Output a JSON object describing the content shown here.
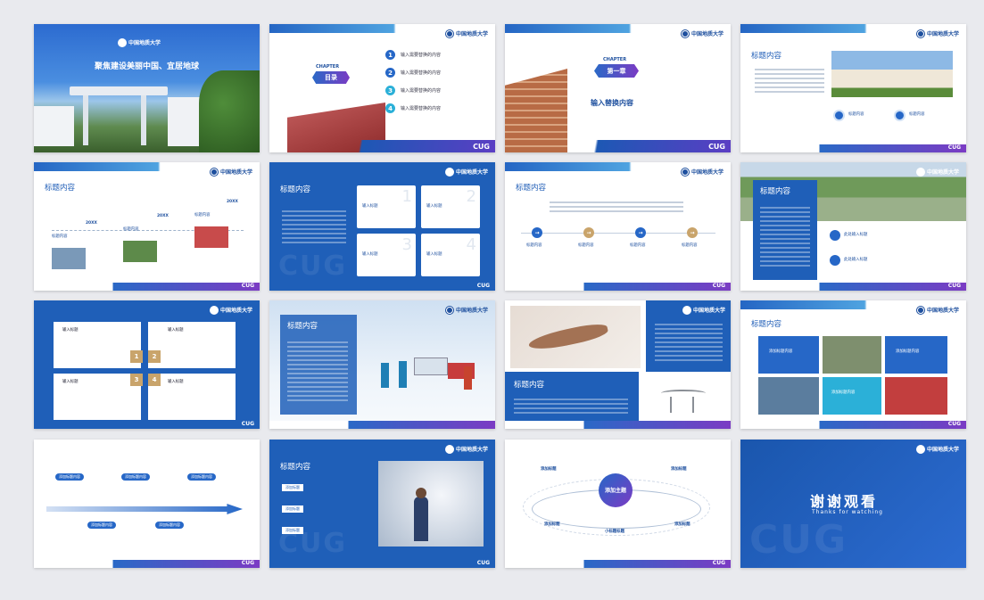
{
  "brand": {
    "logo_text": "中国地质大学",
    "short": "CUG",
    "colors": {
      "primary": "#1f5fb8",
      "accent": "#7b3bc4",
      "gold": "#c9a46b"
    }
  },
  "slides": {
    "cover": {
      "title": "聚焦建设美丽中国、宜居地球"
    },
    "toc": {
      "chapter": "CHAPTER",
      "title": "目录",
      "items": [
        {
          "num": "1",
          "text": "输入需要替换的内容"
        },
        {
          "num": "2",
          "text": "输入需要替换的内容"
        },
        {
          "num": "3",
          "text": "输入需要替换的内容"
        },
        {
          "num": "4",
          "text": "输入需要替换的内容"
        }
      ]
    },
    "chapter1": {
      "chapter": "CHAPTER",
      "title": "第一章",
      "subtitle": "输入替换内容"
    },
    "s4": {
      "title": "标题内容",
      "items": [
        "标题内容",
        "标题内容"
      ]
    },
    "s5": {
      "title": "标题内容",
      "years": [
        "20XX",
        "20XX",
        "20XX"
      ],
      "labels": [
        "标题内容",
        "标题内容",
        "标题内容"
      ]
    },
    "s6": {
      "title": "标题内容",
      "cards": [
        {
          "num": "1",
          "label": "输入标题"
        },
        {
          "num": "2",
          "label": "输入标题"
        },
        {
          "num": "3",
          "label": "输入标题"
        },
        {
          "num": "4",
          "label": "输入标题"
        }
      ]
    },
    "s7": {
      "title": "标题内容",
      "steps": [
        "标题内容",
        "标题内容",
        "标题内容",
        "标题内容"
      ]
    },
    "s8": {
      "title": "标题内容",
      "items": [
        "此处输入标题",
        "此处输入标题"
      ]
    },
    "s9": {
      "cards": [
        {
          "num": "1",
          "label": "输入标题"
        },
        {
          "num": "2",
          "label": "输入标题"
        },
        {
          "num": "3",
          "label": "输入标题"
        },
        {
          "num": "4",
          "label": "输入标题"
        }
      ]
    },
    "s10": {
      "title": "标题内容"
    },
    "s11": {
      "title": "标题内容"
    },
    "s12": {
      "title": "标题内容",
      "tiles": [
        "添加标题内容",
        "添加标题内容",
        "添加标题内容"
      ]
    },
    "s13": {
      "items": [
        "添加标题内容",
        "添加标题内容",
        "添加标题内容",
        "添加标题内容",
        "添加标题内容"
      ]
    },
    "s14": {
      "title": "标题内容",
      "tags": [
        "添加标题",
        "添加标题",
        "添加标题"
      ]
    },
    "s15": {
      "center": "添加主题",
      "labels": [
        "添加标题",
        "添加标题",
        "小标题标题",
        "添加标题",
        "添加标题"
      ]
    },
    "s16": {
      "title": "谢谢观看",
      "subtitle": "Thanks for watching"
    }
  }
}
